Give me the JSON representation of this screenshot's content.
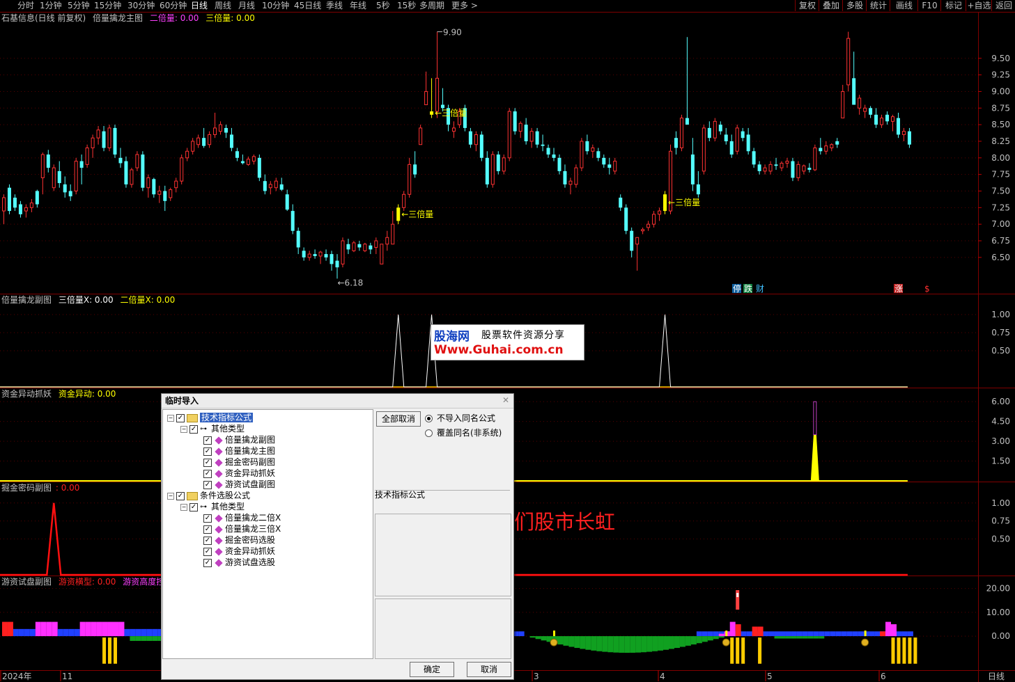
{
  "toolbar": {
    "periods": [
      "分时",
      "1分钟",
      "5分钟",
      "15分钟",
      "30分钟",
      "60分钟",
      "日线",
      "周线",
      "月线",
      "10分钟",
      "45日线",
      "季线",
      "年线",
      "5秒",
      "15秒",
      "多周期",
      "更多 >"
    ],
    "active": "日线",
    "right_buttons": [
      "复权",
      "叠加",
      "多股",
      "统计",
      "画线",
      "F10",
      "标记",
      "+自选",
      "返回"
    ]
  },
  "panels": {
    "main": {
      "name": "石基信息(日线 前复权)",
      "indicator": "倍量擒龙主图",
      "l1": "二倍量: 0.00",
      "l2": "三倍量: 0.00",
      "yticks": [
        "9.50",
        "9.25",
        "9.00",
        "8.75",
        "8.50",
        "8.25",
        "8.00",
        "7.75",
        "7.50",
        "7.25",
        "7.00",
        "6.75",
        "6.50"
      ],
      "max_label": "9.90",
      "min_label": "←6.18",
      "signal_label": "←三倍量",
      "markers": [
        "停",
        "跌",
        "财",
        "涨",
        "$"
      ]
    },
    "p2": {
      "name": "倍量擒龙副图",
      "l1": "三倍量X: 0.00",
      "l2": "二倍量X: 0.00",
      "yticks": [
        "1.00",
        "0.75",
        "0.50"
      ]
    },
    "p3": {
      "name": "资金异动抓妖",
      "l1": "资金异动: 0.00",
      "yticks": [
        "6.00",
        "4.50",
        "3.00",
        "1.50"
      ]
    },
    "p4": {
      "name": "掘金密码副图",
      "l1": ": 0.00",
      "yticks": [
        "1.00",
        "0.75",
        "0.50"
      ]
    },
    "p5": {
      "name": "游资试盘副图",
      "l1": "游资横型: 0.00",
      "l2": "游资高度控",
      "yticks": [
        "20.00",
        "10.00",
        "0.00"
      ]
    }
  },
  "xaxis": {
    "labels": [
      "2024年",
      "11",
      "3",
      "4",
      "5",
      "6"
    ],
    "period": "日线"
  },
  "chart_data": {
    "type": "candlestick",
    "title": "石基信息(日线 前复权)",
    "ylim": [
      6.1,
      9.98
    ],
    "ohlc": [
      [
        7.2,
        7.45,
        7.0,
        7.4
      ],
      [
        7.55,
        7.6,
        7.15,
        7.2
      ],
      [
        7.4,
        7.45,
        7.2,
        7.25
      ],
      [
        7.3,
        7.35,
        7.1,
        7.15
      ],
      [
        7.2,
        7.3,
        7.1,
        7.25
      ],
      [
        7.25,
        7.38,
        7.18,
        7.32
      ],
      [
        7.5,
        7.52,
        7.25,
        7.3
      ],
      [
        7.7,
        8.08,
        7.45,
        8.05
      ],
      [
        8.05,
        8.12,
        7.78,
        7.85
      ],
      [
        7.55,
        7.9,
        7.5,
        7.85
      ],
      [
        7.8,
        7.95,
        7.55,
        7.62
      ],
      [
        7.6,
        7.72,
        7.4,
        7.48
      ],
      [
        7.5,
        7.6,
        7.35,
        7.42
      ],
      [
        7.5,
        8.0,
        7.45,
        7.95
      ],
      [
        7.95,
        8.05,
        7.6,
        7.85
      ],
      [
        7.9,
        8.2,
        7.85,
        8.15
      ],
      [
        8.15,
        8.35,
        8.0,
        8.3
      ],
      [
        8.3,
        8.48,
        8.2,
        8.42
      ],
      [
        8.4,
        8.48,
        8.1,
        8.15
      ],
      [
        8.15,
        8.5,
        8.1,
        8.45
      ],
      [
        8.45,
        8.5,
        8.0,
        8.05
      ],
      [
        8.0,
        8.15,
        7.85,
        7.92
      ],
      [
        7.95,
        8.02,
        7.55,
        7.6
      ],
      [
        7.6,
        7.85,
        7.55,
        7.82
      ],
      [
        7.85,
        8.1,
        7.8,
        8.05
      ],
      [
        8.05,
        8.1,
        7.5,
        7.55
      ],
      [
        7.55,
        7.75,
        7.4,
        7.7
      ],
      [
        7.68,
        7.7,
        7.4,
        7.45
      ],
      [
        7.45,
        7.58,
        7.32,
        7.5
      ],
      [
        7.5,
        7.58,
        7.2,
        7.35
      ],
      [
        7.4,
        7.55,
        7.35,
        7.52
      ],
      [
        7.55,
        7.7,
        7.48,
        7.65
      ],
      [
        7.65,
        8.05,
        7.6,
        8.0
      ],
      [
        8.0,
        8.15,
        7.95,
        8.1
      ],
      [
        8.1,
        8.3,
        8.05,
        8.25
      ],
      [
        8.2,
        8.35,
        8.15,
        8.3
      ],
      [
        8.3,
        8.45,
        8.15,
        8.18
      ],
      [
        8.2,
        8.4,
        8.15,
        8.35
      ],
      [
        8.35,
        8.68,
        8.3,
        8.45
      ],
      [
        8.4,
        8.55,
        8.35,
        8.5
      ],
      [
        8.45,
        8.5,
        8.3,
        8.38
      ],
      [
        8.35,
        8.45,
        8.1,
        8.15
      ],
      [
        8.1,
        8.15,
        7.95,
        8.0
      ],
      [
        7.95,
        8.05,
        7.9,
        7.92
      ],
      [
        7.9,
        8.02,
        7.88,
        7.98
      ],
      [
        7.95,
        8.05,
        7.9,
        8.02
      ],
      [
        8.0,
        8.05,
        7.65,
        7.7
      ],
      [
        7.65,
        7.75,
        7.45,
        7.5
      ],
      [
        7.55,
        7.65,
        7.45,
        7.6
      ],
      [
        7.55,
        7.7,
        7.5,
        7.65
      ],
      [
        7.6,
        7.7,
        7.5,
        7.52
      ],
      [
        7.45,
        7.52,
        7.2,
        7.22
      ],
      [
        7.2,
        7.3,
        6.85,
        6.9
      ],
      [
        6.9,
        6.95,
        6.55,
        6.65
      ],
      [
        6.6,
        6.65,
        6.45,
        6.5
      ],
      [
        6.5,
        6.6,
        6.45,
        6.55
      ],
      [
        6.55,
        6.62,
        6.48,
        6.52
      ],
      [
        6.52,
        6.6,
        6.4,
        6.58
      ],
      [
        6.55,
        6.62,
        6.45,
        6.5
      ],
      [
        6.55,
        6.6,
        6.3,
        6.4
      ],
      [
        6.45,
        6.55,
        6.18,
        6.35
      ],
      [
        6.4,
        6.8,
        6.35,
        6.75
      ],
      [
        6.7,
        6.78,
        6.55,
        6.62
      ],
      [
        6.6,
        6.75,
        6.58,
        6.72
      ],
      [
        6.7,
        6.75,
        6.6,
        6.65
      ],
      [
        6.6,
        6.72,
        6.58,
        6.7
      ],
      [
        6.68,
        6.72,
        6.55,
        6.62
      ],
      [
        6.65,
        6.8,
        6.55,
        6.75
      ],
      [
        6.4,
        6.7,
        6.4,
        6.7
      ],
      [
        6.7,
        6.9,
        6.6,
        6.8
      ],
      [
        6.7,
        7.2,
        6.7,
        7.0
      ],
      [
        7.05,
        7.3,
        7.0,
        7.25
      ],
      [
        7.25,
        7.5,
        7.2,
        7.45
      ],
      [
        7.45,
        8.0,
        7.4,
        7.9
      ],
      [
        7.9,
        8.1,
        7.7,
        7.75
      ],
      [
        8.2,
        8.5,
        8.2,
        8.45
      ],
      [
        8.8,
        9.3,
        8.8,
        9.0
      ],
      [
        8.65,
        9.2,
        8.6,
        8.7
      ],
      [
        8.7,
        9.9,
        8.6,
        9.2
      ],
      [
        8.8,
        9.05,
        8.7,
        8.75
      ],
      [
        8.75,
        8.8,
        8.4,
        8.5
      ],
      [
        8.4,
        8.55,
        8.3,
        8.45
      ],
      [
        8.5,
        8.75,
        8.45,
        8.7
      ],
      [
        8.75,
        8.8,
        8.4,
        8.45
      ],
      [
        8.4,
        8.45,
        8.15,
        8.2
      ],
      [
        8.2,
        8.4,
        8.1,
        8.35
      ],
      [
        8.35,
        8.4,
        7.95,
        8.0
      ],
      [
        8.0,
        8.1,
        7.55,
        7.6
      ],
      [
        7.6,
        8.1,
        7.55,
        8.05
      ],
      [
        8.05,
        8.1,
        7.75,
        7.8
      ],
      [
        7.8,
        8.05,
        7.75,
        8.0
      ],
      [
        8.0,
        8.75,
        7.95,
        8.7
      ],
      [
        8.7,
        8.75,
        8.35,
        8.4
      ],
      [
        8.4,
        8.55,
        8.3,
        8.52
      ],
      [
        8.5,
        8.6,
        8.2,
        8.25
      ],
      [
        8.25,
        8.45,
        8.15,
        8.4
      ],
      [
        8.4,
        8.45,
        8.15,
        8.2
      ],
      [
        8.2,
        8.35,
        8.1,
        8.18
      ],
      [
        8.15,
        8.2,
        8.0,
        8.05
      ],
      [
        8.05,
        8.15,
        7.95,
        8.0
      ],
      [
        8.0,
        8.05,
        7.75,
        7.8
      ],
      [
        7.8,
        7.9,
        7.55,
        7.6
      ],
      [
        7.6,
        7.7,
        7.45,
        7.65
      ],
      [
        7.6,
        7.9,
        7.55,
        7.85
      ],
      [
        7.85,
        8.3,
        7.8,
        8.25
      ],
      [
        8.25,
        8.35,
        8.05,
        8.1
      ],
      [
        8.1,
        8.2,
        8.0,
        8.15
      ],
      [
        8.1,
        8.15,
        7.95,
        8.0
      ],
      [
        8.0,
        8.05,
        7.85,
        7.9
      ],
      [
        7.9,
        8.0,
        7.75,
        7.85
      ],
      [
        7.8,
        8.0,
        7.75,
        7.95
      ],
      [
        7.4,
        7.45,
        7.2,
        7.25
      ],
      [
        7.25,
        7.3,
        6.85,
        6.9
      ],
      [
        6.9,
        6.95,
        6.5,
        6.6
      ],
      [
        6.7,
        6.8,
        6.3,
        6.8
      ],
      [
        6.9,
        6.95,
        6.85,
        6.92
      ],
      [
        6.95,
        7.05,
        6.9,
        7.0
      ],
      [
        7.0,
        7.2,
        6.95,
        7.15
      ],
      [
        7.15,
        7.25,
        7.05,
        7.2
      ],
      [
        7.2,
        7.5,
        7.15,
        7.45
      ],
      [
        7.2,
        8.2,
        7.15,
        8.1
      ],
      [
        8.3,
        8.4,
        8.05,
        8.15
      ],
      [
        8.15,
        8.65,
        8.1,
        8.6
      ],
      [
        8.6,
        9.82,
        8.55,
        8.5
      ],
      [
        8.05,
        8.3,
        7.5,
        7.6
      ],
      [
        7.6,
        7.8,
        7.4,
        7.45
      ],
      [
        7.8,
        8.5,
        7.75,
        8.45
      ],
      [
        8.45,
        8.55,
        8.25,
        8.3
      ],
      [
        8.3,
        8.6,
        8.25,
        8.55
      ],
      [
        8.5,
        8.55,
        8.35,
        8.4
      ],
      [
        8.35,
        8.45,
        8.2,
        8.25
      ],
      [
        8.25,
        8.35,
        8.0,
        8.05
      ],
      [
        8.1,
        8.5,
        8.05,
        8.45
      ],
      [
        8.4,
        8.45,
        8.25,
        8.3
      ],
      [
        8.35,
        8.45,
        8.05,
        8.1
      ],
      [
        8.1,
        8.15,
        7.85,
        7.9
      ],
      [
        7.9,
        7.95,
        7.75,
        7.8
      ],
      [
        7.8,
        7.9,
        7.75,
        7.85
      ],
      [
        7.8,
        7.95,
        7.75,
        7.9
      ],
      [
        7.9,
        8.0,
        7.82,
        7.88
      ],
      [
        7.85,
        7.95,
        7.8,
        7.92
      ],
      [
        7.92,
        8.0,
        7.85,
        7.95
      ],
      [
        7.95,
        8.0,
        7.65,
        7.7
      ],
      [
        7.7,
        7.95,
        7.65,
        7.9
      ],
      [
        7.8,
        7.9,
        7.75,
        7.88
      ],
      [
        7.85,
        7.92,
        7.78,
        7.82
      ],
      [
        7.82,
        8.2,
        7.8,
        8.15
      ],
      [
        8.15,
        8.3,
        8.05,
        8.1
      ],
      [
        8.1,
        8.25,
        8.05,
        8.18
      ],
      [
        8.15,
        8.22,
        8.1,
        8.2
      ],
      [
        8.25,
        8.3,
        8.15,
        8.2
      ],
      [
        8.6,
        9.1,
        8.6,
        9.0
      ],
      [
        9.1,
        9.9,
        9.0,
        9.8
      ],
      [
        9.2,
        9.6,
        8.8,
        8.8
      ],
      [
        8.75,
        8.95,
        8.65,
        8.9
      ],
      [
        8.7,
        8.8,
        8.6,
        8.75
      ],
      [
        8.75,
        8.78,
        8.6,
        8.65
      ],
      [
        8.65,
        8.75,
        8.45,
        8.5
      ],
      [
        8.5,
        8.65,
        8.45,
        8.6
      ],
      [
        8.65,
        8.7,
        8.5,
        8.55
      ],
      [
        8.55,
        8.65,
        8.4,
        8.62
      ],
      [
        8.6,
        8.68,
        8.3,
        8.35
      ],
      [
        8.35,
        8.45,
        8.25,
        8.4
      ],
      [
        8.4,
        8.45,
        8.15,
        8.2
      ]
    ],
    "highlight_bars": [
      {
        "index": 71,
        "label": "←三倍量"
      },
      {
        "index": 77,
        "label": "←三倍量"
      },
      {
        "index": 119,
        "label": "←三倍量"
      }
    ],
    "p2_line": {
      "name": "三倍量X",
      "peaks": [
        71,
        77,
        119
      ],
      "ylim": [
        0,
        1.25
      ]
    },
    "p3_bar": {
      "name": "资金异动",
      "peak_index": 146,
      "peak_values": [
        6.0,
        3.5
      ],
      "ylim": [
        0,
        6.8
      ]
    },
    "p4_line": {
      "name": "掘金密码",
      "peaks": [
        9
      ],
      "ylim": [
        0,
        1.25
      ]
    },
    "p5": {
      "name": "游资试盘",
      "ylim": [
        -14,
        24
      ]
    }
  },
  "dialog": {
    "title": "临时导入",
    "close": "✕",
    "tree": [
      {
        "label": "技术指标公式",
        "level": 0,
        "type": "folder",
        "selected": true
      },
      {
        "label": "其他类型",
        "level": 1,
        "type": "key"
      },
      {
        "label": "倍量擒龙副图",
        "level": 2,
        "type": "item"
      },
      {
        "label": "倍量擒龙主图",
        "level": 2,
        "type": "item"
      },
      {
        "label": "掘金密码副图",
        "level": 2,
        "type": "item"
      },
      {
        "label": "资金异动抓妖",
        "level": 2,
        "type": "item"
      },
      {
        "label": "游资试盘副图",
        "level": 2,
        "type": "item"
      },
      {
        "label": "条件选股公式",
        "level": 0,
        "type": "folder"
      },
      {
        "label": "其他类型",
        "level": 1,
        "type": "key"
      },
      {
        "label": "倍量擒龙二倍X",
        "level": 2,
        "type": "item"
      },
      {
        "label": "倍量擒龙三倍X",
        "level": 2,
        "type": "item"
      },
      {
        "label": "掘金密码选股",
        "level": 2,
        "type": "item"
      },
      {
        "label": "资金异动抓妖",
        "level": 2,
        "type": "item"
      },
      {
        "label": "游资试盘选股",
        "level": 2,
        "type": "item"
      }
    ],
    "cancel_all": "全部取消",
    "radio1": "不导入同名公式",
    "radio2": "覆盖同名(非系统)",
    "type_label": "技术指标公式",
    "ok": "确定",
    "cancel": "取消"
  },
  "watermark": {
    "brand": "股海网",
    "slogan": "股票软件资源分享",
    "url": "Www.Guhai.com.cn"
  },
  "blessing": "祝股友们股市长虹"
}
